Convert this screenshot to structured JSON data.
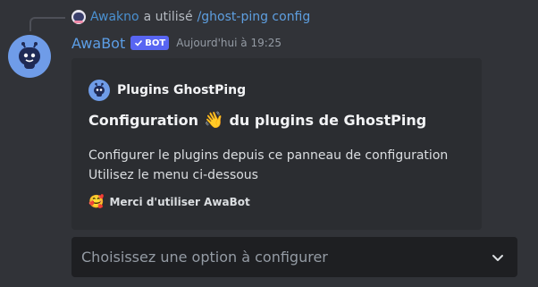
{
  "reply": {
    "username": "Awakno",
    "action_text": "a utilisé",
    "command": "/ghost-ping config"
  },
  "message": {
    "username": "AwaBot",
    "bot_tag": "BOT",
    "timestamp": "Aujourd'hui à 19:25"
  },
  "embed": {
    "author_name": "Plugins GhostPing",
    "title_prefix": "Configuration",
    "title_emoji": "👋",
    "title_suffix": "du plugins de GhostPing",
    "description_lines": [
      "Configurer le plugins depuis ce panneau de configuration",
      "Utilisez le menu ci-dessous"
    ],
    "footer_emoji": "🥰",
    "footer_text": "Merci d'utiliser AwaBot"
  },
  "select_menu": {
    "placeholder": "Choisissez une option à configurer",
    "icon": "chevron-down-icon"
  },
  "colors": {
    "background": "#313338",
    "embed_background": "#2b2d31",
    "select_background": "#1e1f22",
    "bot_tag": "#5865f2",
    "username": "#5c9ee6",
    "avatar": "#6f9ce8"
  }
}
